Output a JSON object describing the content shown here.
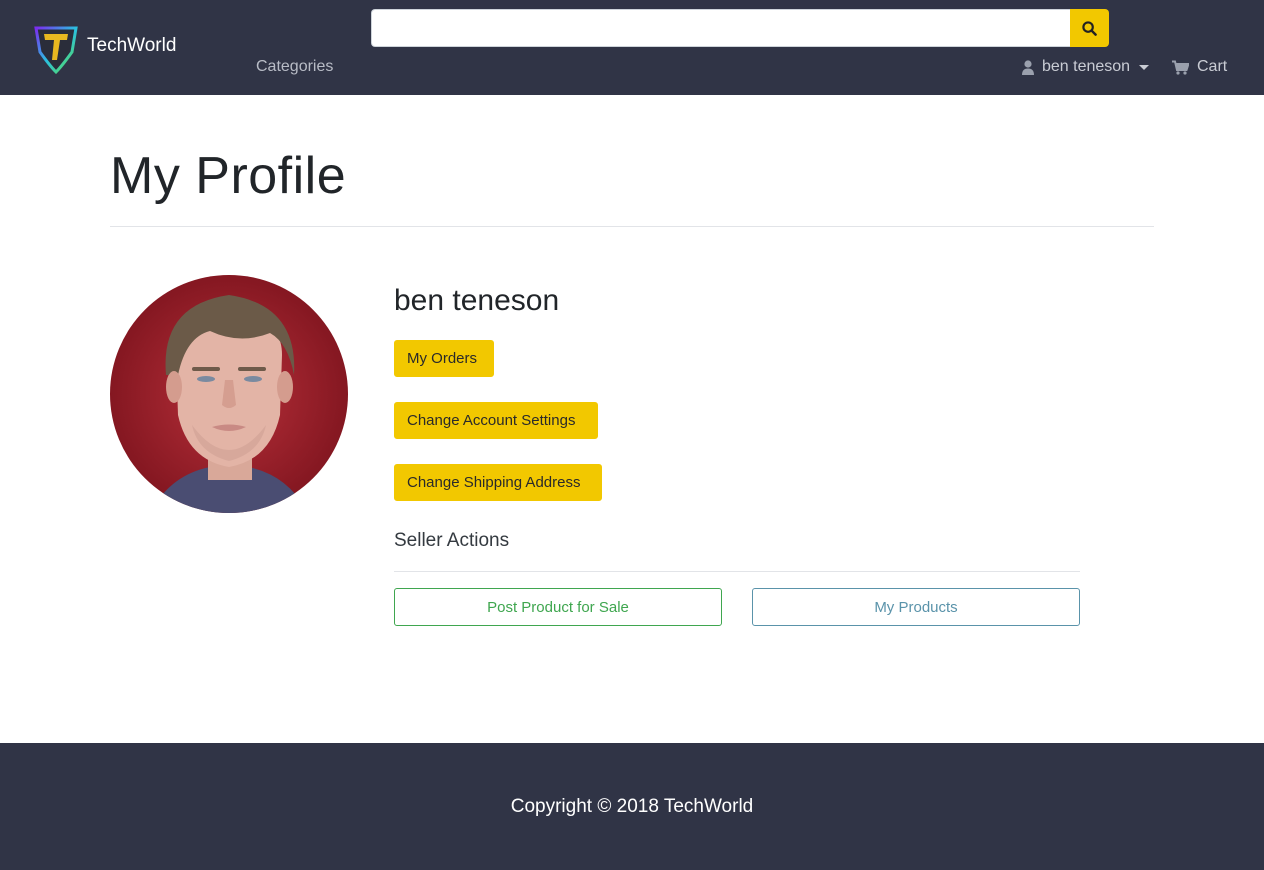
{
  "navbar": {
    "brand_name": "TechWorld",
    "categories_label": "Categories",
    "search": {
      "value": "",
      "placeholder": ""
    },
    "user_name": "ben teneson",
    "cart_label": "Cart"
  },
  "page": {
    "title": "My Profile"
  },
  "profile": {
    "name": "ben teneson",
    "buttons": {
      "orders": "My Orders",
      "account_settings": "Change Account Settings",
      "shipping_address": "Change Shipping Address"
    },
    "seller": {
      "heading": "Seller Actions",
      "post_product": "Post Product for Sale",
      "my_products": "My Products"
    }
  },
  "footer": {
    "copyright": "Copyright © 2018 TechWorld"
  },
  "colors": {
    "navbar_bg": "#303446",
    "accent_yellow": "#f2c800",
    "success_green": "#3fa64f",
    "info_blue": "#5a93aa"
  },
  "icons": [
    "techworld-logo",
    "search-icon",
    "user-icon",
    "caret-down-icon",
    "cart-icon"
  ]
}
